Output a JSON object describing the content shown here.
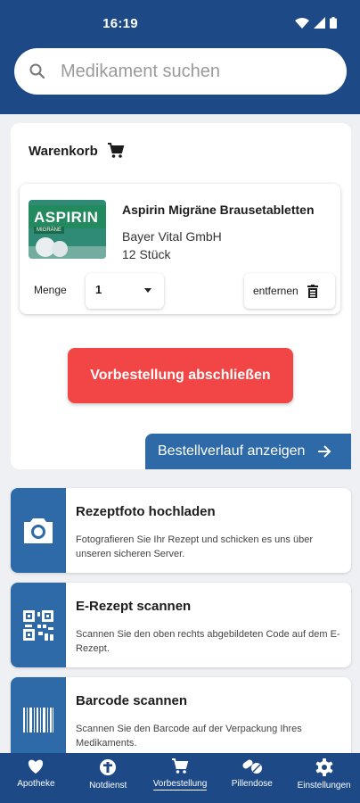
{
  "status_bar": {
    "time": "16:19"
  },
  "search": {
    "placeholder": "Medikament suchen"
  },
  "cart": {
    "title": "Warenkorb",
    "item": {
      "name": "Aspirin Migräne Brausetabletten",
      "manufacturer": "Bayer Vital GmbH",
      "package": "12 Stück",
      "image_brand": "ASPIRIN",
      "image_sub": "MIGRÄNE",
      "quantity_label": "Menge",
      "quantity_value": "1",
      "remove_label": "entfernen"
    },
    "order_button": "Vorbestellung abschließen",
    "history_button": "Bestellverlauf anzeigen"
  },
  "actions": [
    {
      "title": "Rezeptfoto hochladen",
      "description": "Fotografieren Sie Ihr Rezept und schicken es uns über unseren sicheren Server.",
      "icon": "camera-icon"
    },
    {
      "title": "E-Rezept scannen",
      "description": "Scannen Sie den oben rechts abgebildeten Code auf dem E-Rezept.",
      "icon": "qr-code-icon"
    },
    {
      "title": "Barcode scannen",
      "description": "Scannen Sie den Barcode auf der Verpackung Ihres Medikaments.",
      "icon": "barcode-icon"
    }
  ],
  "nav": [
    {
      "label": "Apotheke",
      "icon": "heart-icon"
    },
    {
      "label": "Notdienst",
      "icon": "medical-emergency-icon"
    },
    {
      "label": "Vorbestellung",
      "icon": "cart-icon",
      "active": true
    },
    {
      "label": "Pillendose",
      "icon": "pills-icon"
    },
    {
      "label": "Einstellungen",
      "icon": "gear-icon"
    }
  ],
  "colors": {
    "primary": "#1d4a86",
    "accent": "#2d6aa7",
    "danger": "#f24545",
    "background": "#eef0f3"
  }
}
